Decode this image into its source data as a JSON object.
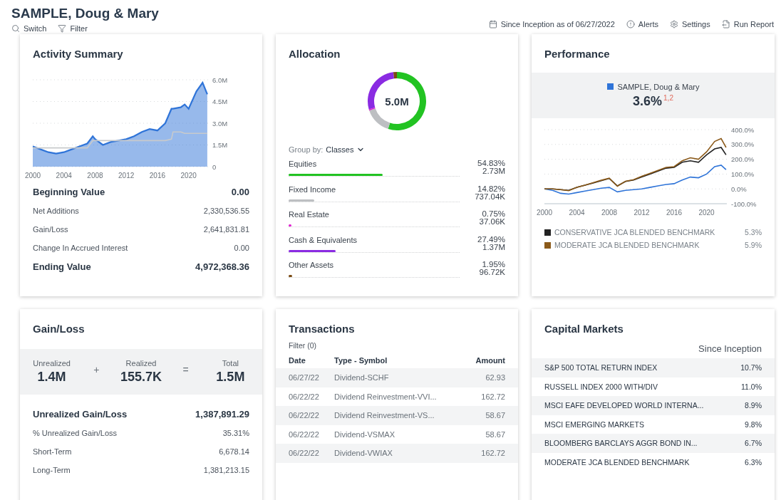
{
  "header": {
    "title": "SAMPLE, Doug & Mary",
    "actions": [
      {
        "kind": "search",
        "label": "Switch"
      },
      {
        "kind": "filter",
        "label": "Filter"
      }
    ],
    "tools": [
      {
        "kind": "calendar",
        "label": "Since Inception as of 06/27/2022"
      },
      {
        "kind": "alert",
        "label": "Alerts"
      },
      {
        "kind": "settings",
        "label": "Settings"
      },
      {
        "kind": "report",
        "label": "Run Report"
      }
    ]
  },
  "activity_summary": {
    "title": "Activity Summary",
    "chart_data": {
      "type": "area",
      "x": [
        2000,
        2001,
        2002,
        2003,
        2004,
        2005,
        2006,
        2007,
        2007.7,
        2008,
        2009,
        2010,
        2011,
        2012,
        2013,
        2014,
        2015,
        2016,
        2017,
        2017.8,
        2018,
        2019,
        2019.5,
        2020,
        2021,
        2021.8,
        2022.4
      ],
      "grid": true,
      "series": [
        {
          "color": "#2f74d8",
          "values": [
            1.4,
            1.2,
            1.0,
            0.9,
            1.0,
            1.2,
            1.4,
            1.6,
            2.1,
            1.9,
            1.5,
            1.7,
            1.8,
            1.9,
            2.1,
            2.4,
            2.6,
            2.5,
            3.0,
            4.0,
            4.0,
            4.1,
            4.3,
            4.0,
            5.2,
            5.8,
            5.0
          ]
        },
        {
          "type": "line",
          "color": "#c8cacc",
          "values": [
            1.3,
            1.3,
            1.3,
            1.3,
            1.3,
            1.3,
            1.3,
            1.3,
            1.8,
            1.8,
            1.8,
            1.8,
            1.8,
            1.8,
            1.8,
            1.8,
            1.8,
            1.8,
            1.8,
            1.9,
            2.4,
            2.4,
            2.3,
            2.3,
            2.3,
            2.3,
            2.3
          ]
        }
      ],
      "xlim": [
        2000,
        2022.5
      ],
      "ylim": [
        0,
        6
      ],
      "xticks": [
        2000,
        2004,
        2008,
        2012,
        2016,
        2020
      ],
      "yticks": [
        {
          "value": 0,
          "label": "0"
        },
        {
          "value": 1.5,
          "label": "1.5M"
        },
        {
          "value": 3,
          "label": "3.0M"
        },
        {
          "value": 4.5,
          "label": "4.5M"
        },
        {
          "value": 6,
          "label": "6.0M"
        }
      ]
    },
    "rows": [
      {
        "kind": "total",
        "label": "Beginning Value",
        "value": "0.00"
      },
      {
        "kind": "detail",
        "label": "Net Additions",
        "value": "2,330,536.55"
      },
      {
        "kind": "detail",
        "label": "Gain/Loss",
        "value": "2,641,831.81"
      },
      {
        "kind": "detail",
        "label": "Change In Accrued Interest",
        "value": "0.00"
      },
      {
        "kind": "total",
        "label": "Ending Value",
        "value": "4,972,368.36"
      }
    ]
  },
  "allocation": {
    "title": "Allocation",
    "total": "5.0M",
    "group_by": {
      "label": "Group by:",
      "value": "Classes"
    },
    "items": [
      {
        "label": "Equities",
        "percent": "54.83%",
        "amount": "2.73M",
        "level": 0.5483,
        "color": "#22c322"
      },
      {
        "label": "Fixed Income",
        "percent": "14.82%",
        "amount": "737.04K",
        "level": 0.1482,
        "color": "#bdbfc2"
      },
      {
        "label": "Real Estate",
        "percent": "0.75%",
        "amount": "37.06K",
        "level": 0.0075,
        "color": "#e020d0"
      },
      {
        "label": "Cash & Equivalents",
        "percent": "27.49%",
        "amount": "1.37M",
        "level": 0.2749,
        "color": "#8a2be2"
      },
      {
        "label": "Other Assets",
        "percent": "1.95%",
        "amount": "96.72K",
        "level": 0.0195,
        "color": "#7a4a12"
      }
    ]
  },
  "performance": {
    "title": "Performance",
    "account": {
      "return": "3.6%$^{1,2}$"
    },
    "chart_data": {
      "type": "line",
      "grid": true,
      "x": [
        2000,
        2001,
        2002,
        2003,
        2004,
        2005,
        2006,
        2007,
        2008,
        2009,
        2010,
        2011,
        2012,
        2013,
        2014,
        2015,
        2016,
        2017,
        2018,
        2019,
        2020,
        2021,
        2021.8,
        2022.4
      ],
      "series": [
        {
          "name": "SAMPLE, Doug & Mary",
          "color": "#2f74d8",
          "values": [
            0,
            -10,
            -30,
            -35,
            -25,
            -15,
            -5,
            5,
            10,
            -20,
            -10,
            -5,
            0,
            10,
            20,
            30,
            35,
            60,
            80,
            75,
            100,
            150,
            160,
            130
          ]
        },
        {
          "name": "CONSERVATIVE JCA BLENDED BENCHMARK",
          "color": "#222222",
          "values": [
            0,
            0,
            -5,
            -10,
            10,
            25,
            40,
            55,
            70,
            20,
            50,
            60,
            80,
            100,
            120,
            140,
            145,
            180,
            190,
            180,
            230,
            270,
            280,
            230
          ]
        },
        {
          "name": "MODERATE JCA BLENDED BENCHMARK",
          "color": "#8b5a1a",
          "values": [
            0,
            0,
            -5,
            -12,
            10,
            25,
            42,
            58,
            72,
            18,
            52,
            62,
            85,
            105,
            125,
            145,
            150,
            190,
            210,
            200,
            250,
            320,
            340,
            280
          ]
        }
      ],
      "xlim": [
        2000,
        2022.5
      ],
      "ylim": [
        -100,
        400
      ],
      "xticks": [
        2000,
        2004,
        2008,
        2012,
        2016,
        2020
      ],
      "yticks": [
        {
          "value": -100,
          "label": "-100.0%"
        },
        {
          "value": 0,
          "label": "0.0%"
        },
        {
          "value": 100,
          "label": "100.0%"
        },
        {
          "value": 200,
          "label": "200.0%"
        },
        {
          "value": 300,
          "label": "300.0%"
        },
        {
          "value": 400,
          "label": "400.0%"
        }
      ]
    },
    "benchmarks": [
      {
        "value": "5.3%"
      },
      {
        "value": "5.9%"
      }
    ]
  },
  "gain_loss": {
    "title": "Gain/Loss",
    "summary": [
      {
        "label": "Unrealized",
        "value": "1.4M"
      },
      {
        "label": "Realized",
        "value": "155.7K"
      },
      {
        "label": "Total",
        "value": "1.5M"
      }
    ],
    "operators": [
      "+",
      "="
    ],
    "rows": [
      {
        "kind": "total",
        "label": "Unrealized Gain/Loss",
        "value": "1,387,891.29"
      },
      {
        "kind": "detail",
        "label": "% Unrealized Gain/Loss",
        "value": "35.31%"
      },
      {
        "kind": "detail",
        "label": "Short-Term",
        "value": "6,678.14"
      },
      {
        "kind": "detail",
        "label": "Long-Term",
        "value": "1,381,213.15"
      }
    ]
  },
  "transactions": {
    "title": "Transactions",
    "filter": "Filter (0)",
    "columns": [
      "Date",
      "Type - Symbol",
      "Amount"
    ],
    "rows": [
      [
        "06/27/22",
        "Dividend-SCHF",
        "62.93"
      ],
      [
        "06/22/22",
        "Dividend Reinvestment-VVI...",
        "162.72"
      ],
      [
        "06/22/22",
        "Dividend Reinvestment-VS...",
        "58.67"
      ],
      [
        "06/22/22",
        "Dividend-VSMAX",
        "58.67"
      ],
      [
        "06/22/22",
        "Dividend-VWIAX",
        "162.72"
      ]
    ]
  },
  "capital_markets": {
    "title": "Capital Markets",
    "column": "Since Inception",
    "rows": [
      [
        "S&P 500 TOTAL RETURN INDEX",
        "10.7%"
      ],
      [
        "RUSSELL INDEX 2000 WITH/DIV",
        "11.0%"
      ],
      [
        "MSCI EAFE DEVELOPED WORLD INTERNA...",
        "8.9%"
      ],
      [
        "MSCI EMERGING MARKETS",
        "9.8%"
      ],
      [
        "BLOOMBERG BARCLAYS AGGR BOND IN...",
        "6.7%"
      ],
      [
        "MODERATE JCA BLENDED BENCHMARK",
        "6.3%"
      ]
    ]
  }
}
